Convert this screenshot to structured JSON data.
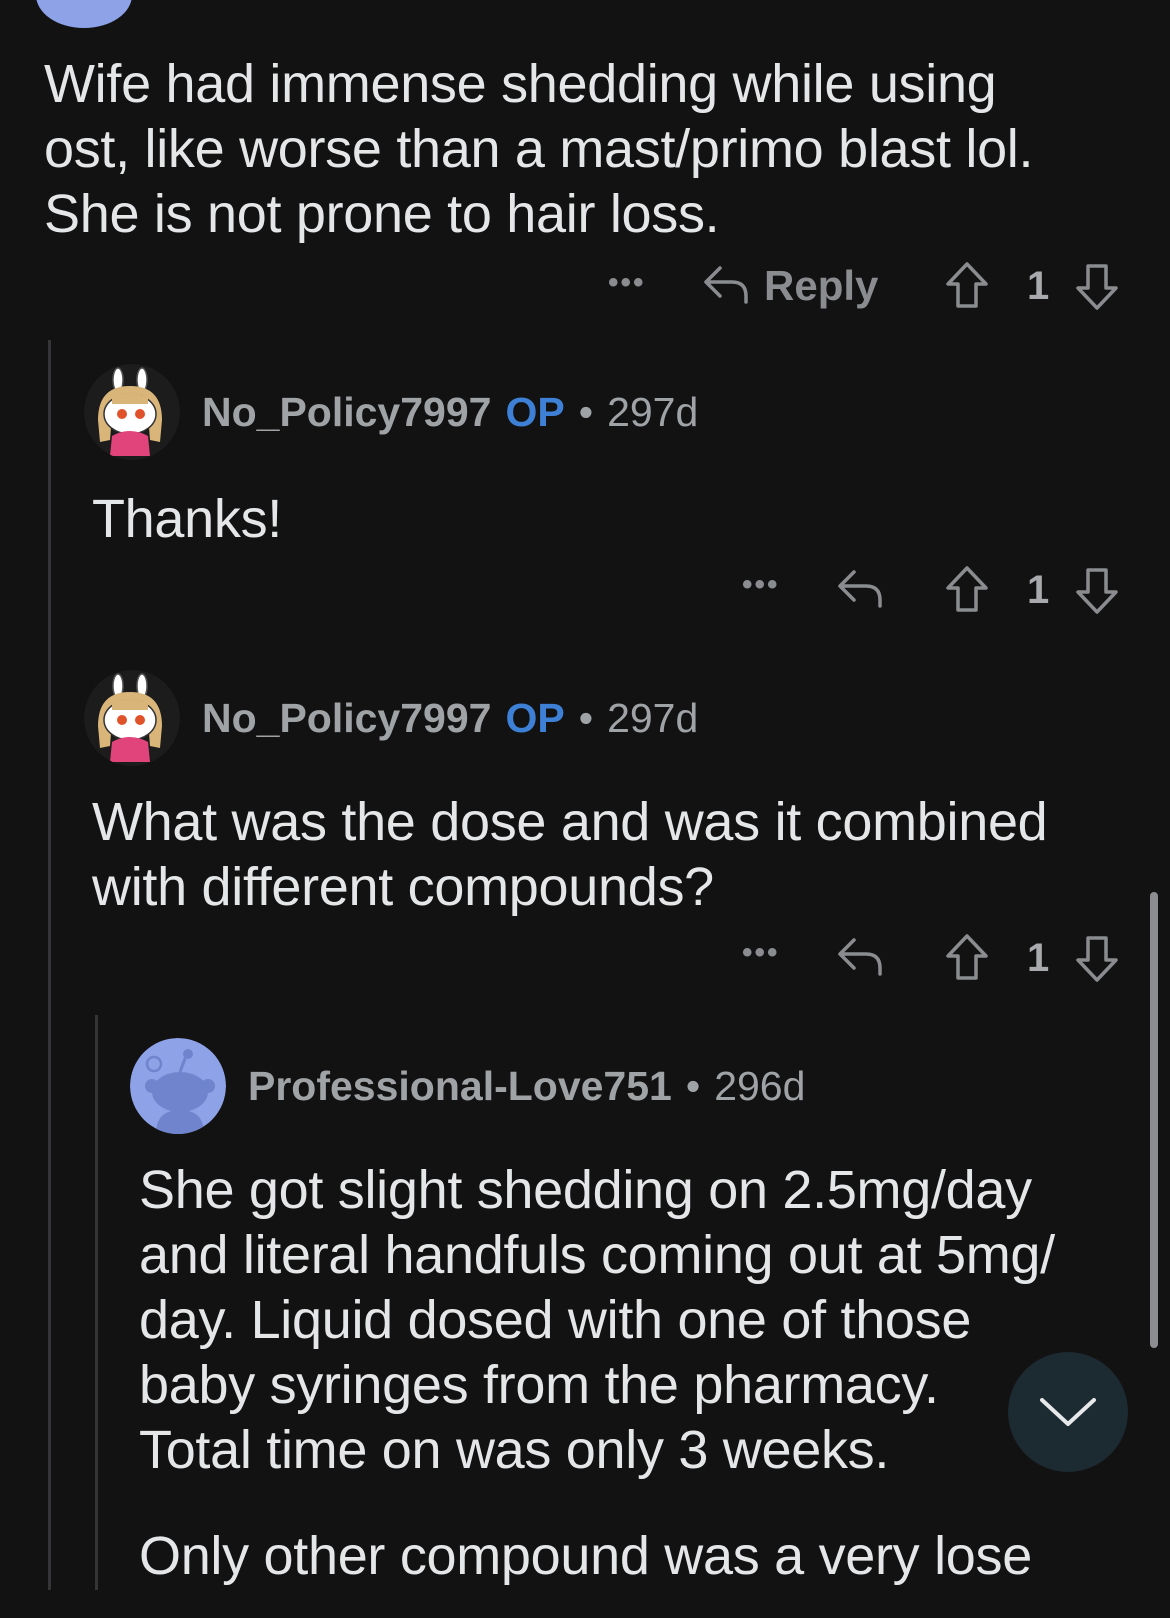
{
  "comments": [
    {
      "text_lines": [
        "Wife had immense shedding while using",
        "ost, like worse than a mast/primo blast lol.",
        "She is not prone to hair loss."
      ],
      "reply_label": "Reply",
      "votes": "1"
    },
    {
      "author": "No_Policy7997",
      "op_badge": "OP",
      "separator": "•",
      "age": "297d",
      "text_lines": [
        "Thanks!"
      ],
      "votes": "1"
    },
    {
      "author": "No_Policy7997",
      "op_badge": "OP",
      "separator": "•",
      "age": "297d",
      "text_lines": [
        "What was the dose and was it combined",
        "with different compounds?"
      ],
      "votes": "1"
    },
    {
      "author": "Professional-Love751",
      "separator": "•",
      "age": "296d",
      "text_lines": [
        "She got slight shedding on 2.5mg/day",
        "and literal handfuls coming out at 5mg/",
        "day. Liquid dosed with one of those",
        "baby syringes from the pharmacy.",
        "Total time on was only 3 weeks."
      ],
      "text_lines_2": [
        "Only other compound was a very lose"
      ]
    }
  ],
  "icons": {
    "more": "more-options-icon",
    "reply": "reply-arrow-icon",
    "upvote": "upvote-arrow-icon",
    "downvote": "downvote-arrow-icon",
    "scroll_down": "chevron-down-icon"
  },
  "colors": {
    "background": "#121213",
    "op_badge": "#3d80d6",
    "meta_text": "#a0a3a6",
    "body_text": "#e4e6e8",
    "fab_background": "#1c2a31",
    "default_avatar": "#8ea2e8"
  }
}
